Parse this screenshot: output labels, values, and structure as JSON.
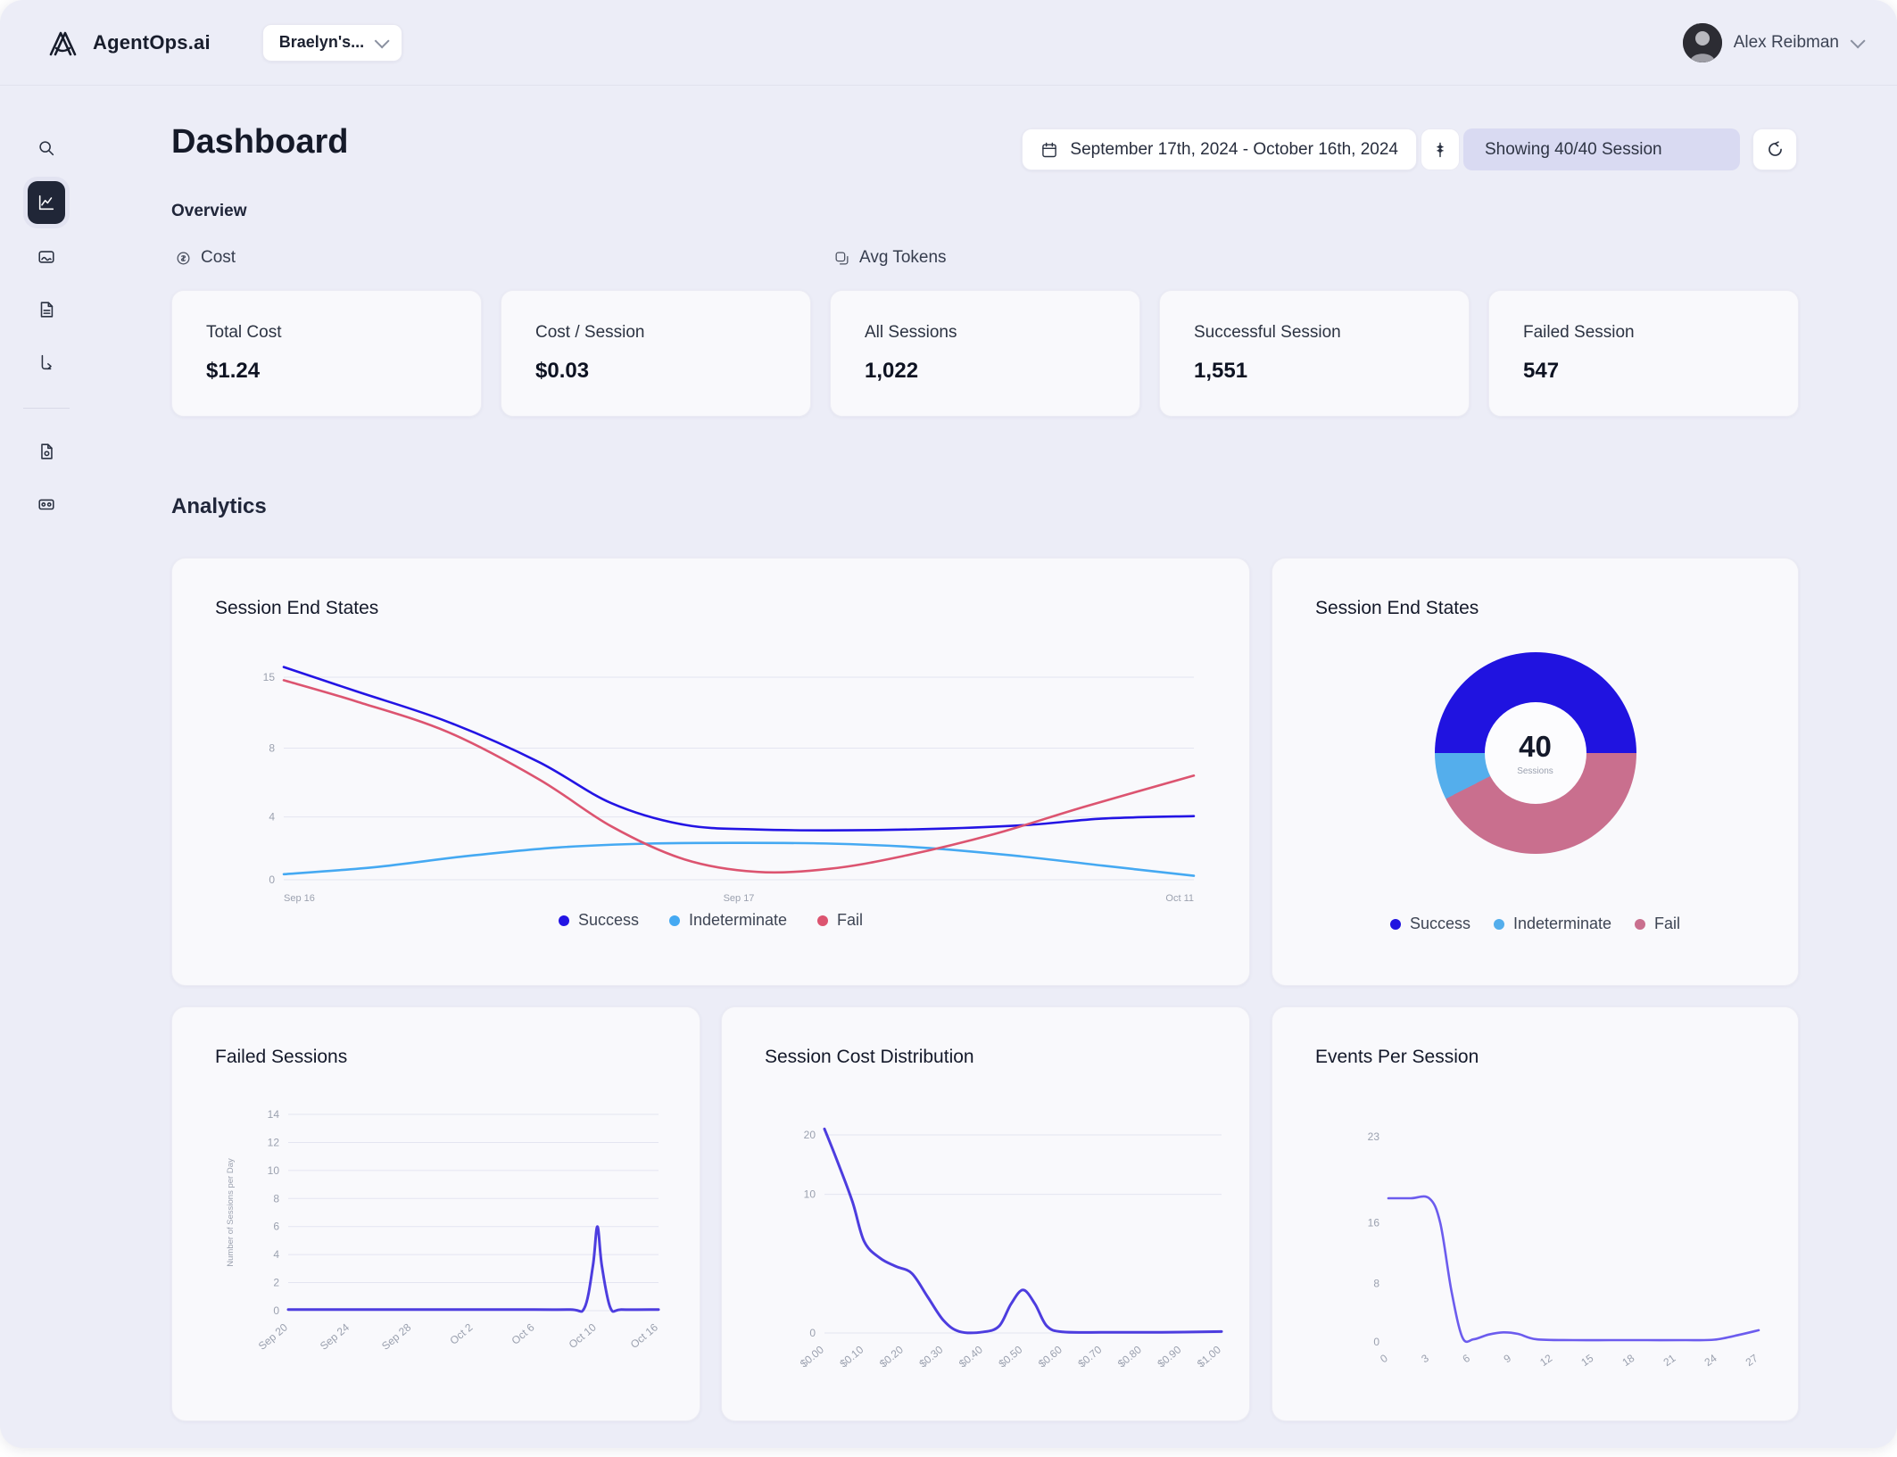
{
  "topbar": {
    "brand": "AgentOps.ai",
    "project_selector": "Braelyn's...",
    "user_name": "Alex Reibman"
  },
  "sidebar": {
    "items": [
      {
        "name": "search"
      },
      {
        "name": "dashboard",
        "active": true
      },
      {
        "name": "sessions"
      },
      {
        "name": "logs"
      },
      {
        "name": "traces"
      },
      {
        "name": "docs"
      },
      {
        "name": "api-keys"
      }
    ]
  },
  "header": {
    "title": "Dashboard",
    "date_range": "September 17th, 2024 - October 16th, 2024",
    "showing": "Showing 40/40 Session"
  },
  "overview": {
    "section_label": "Overview",
    "toggles": [
      {
        "label": "Cost",
        "icon": "coin-icon"
      },
      {
        "label": "Avg Tokens",
        "icon": "tokens-icon"
      }
    ],
    "cards": [
      {
        "label": "Total Cost",
        "value": "$1.24"
      },
      {
        "label": "Cost / Session",
        "value": "$0.03"
      },
      {
        "label": "All Sessions",
        "value": "1,022"
      },
      {
        "label": "Successful Session",
        "value": "1,551"
      },
      {
        "label": "Failed Session",
        "value": "547"
      }
    ]
  },
  "analytics": {
    "section_label": "Analytics"
  },
  "colors": {
    "success": "#2314e4",
    "indeterminate": "#45a9f2",
    "fail": "#dc5470",
    "fail_donut": "#c96f8e",
    "indigo_line": "#4d3ddf",
    "events_line": "#6c5cee",
    "grid": "#e4e5f1",
    "tick_text": "#9ba1af"
  },
  "chart_data": [
    {
      "type": "line",
      "title": "Session End States",
      "legend": [
        "Success",
        "Indeterminate",
        "Fail"
      ],
      "x_labels": [
        "Sep 16",
        "Sep 17",
        "Oct 11"
      ],
      "x_label_fracs": [
        0,
        0.5,
        1
      ],
      "y_ticks": [
        {
          "label": "0",
          "v": 0,
          "f": 0
        },
        {
          "label": "4",
          "v": 4,
          "f": 0.31
        },
        {
          "label": "8",
          "v": 8,
          "f": 0.65
        },
        {
          "label": "15",
          "v": 15,
          "f": 1
        }
      ],
      "series": [
        {
          "name": "Success",
          "color": "#2314e4",
          "points": [
            [
              0,
              16
            ],
            [
              0.08,
              13.6
            ],
            [
              0.18,
              10.6
            ],
            [
              0.28,
              7.2
            ],
            [
              0.36,
              4.8
            ],
            [
              0.44,
              3.5
            ],
            [
              0.52,
              3.2
            ],
            [
              0.62,
              3.15
            ],
            [
              0.72,
              3.25
            ],
            [
              0.82,
              3.5
            ],
            [
              0.9,
              3.9
            ],
            [
              1,
              4.05
            ]
          ]
        },
        {
          "name": "Indeterminate",
          "color": "#45a9f2",
          "points": [
            [
              0,
              0.35
            ],
            [
              0.1,
              0.8
            ],
            [
              0.2,
              1.5
            ],
            [
              0.3,
              2.05
            ],
            [
              0.4,
              2.3
            ],
            [
              0.5,
              2.35
            ],
            [
              0.6,
              2.3
            ],
            [
              0.7,
              2.05
            ],
            [
              0.8,
              1.55
            ],
            [
              0.9,
              0.9
            ],
            [
              1,
              0.25
            ]
          ]
        },
        {
          "name": "Fail",
          "color": "#dc5470",
          "points": [
            [
              0,
              14.7
            ],
            [
              0.08,
              12.6
            ],
            [
              0.18,
              9.6
            ],
            [
              0.28,
              6.2
            ],
            [
              0.36,
              3.4
            ],
            [
              0.44,
              1.3
            ],
            [
              0.52,
              0.5
            ],
            [
              0.6,
              0.7
            ],
            [
              0.68,
              1.5
            ],
            [
              0.78,
              2.9
            ],
            [
              0.88,
              4.6
            ],
            [
              1,
              6.4
            ]
          ]
        }
      ]
    },
    {
      "type": "pie",
      "title": "Session End States",
      "center_value": "40",
      "center_label": "Sessions",
      "legend": [
        "Success",
        "Indeterminate",
        "Fail"
      ],
      "slices": [
        {
          "label": "Success",
          "value": 20,
          "color": "#2013e0"
        },
        {
          "label": "Fail",
          "value": 17,
          "color": "#c96f8e"
        },
        {
          "label": "Indeterminate",
          "value": 3,
          "color": "#54aeec"
        }
      ],
      "total": 40
    },
    {
      "type": "line",
      "title": "Failed Sessions",
      "ylabel": "Number of Sessions per Day",
      "x_labels": [
        "Sep 20",
        "Sep 24",
        "Sep 28",
        "Oct 2",
        "Oct 6",
        "Oct 10",
        "Oct 16"
      ],
      "y_ticks": [
        {
          "label": "0",
          "v": 0,
          "f": 0
        },
        {
          "label": "2",
          "v": 2,
          "f": 0.1429
        },
        {
          "label": "4",
          "v": 4,
          "f": 0.2857
        },
        {
          "label": "6",
          "v": 6,
          "f": 0.4286
        },
        {
          "label": "8",
          "v": 8,
          "f": 0.5714
        },
        {
          "label": "10",
          "v": 10,
          "f": 0.7143
        },
        {
          "label": "12",
          "v": 12,
          "f": 0.8571
        },
        {
          "label": "14",
          "v": 14,
          "f": 1
        }
      ],
      "series": [
        {
          "name": "Failed Sessions",
          "color": "#4d3ddf",
          "points": [
            [
              0,
              0.08
            ],
            [
              0.2,
              0.08
            ],
            [
              0.4,
              0.08
            ],
            [
              0.6,
              0.08
            ],
            [
              0.76,
              0.08
            ],
            [
              0.8,
              0.2
            ],
            [
              0.823,
              3.2
            ],
            [
              0.835,
              6
            ],
            [
              0.847,
              3.2
            ],
            [
              0.87,
              0.2
            ],
            [
              0.9,
              0.08
            ],
            [
              1,
              0.08
            ]
          ]
        }
      ]
    },
    {
      "type": "line",
      "title": "Session Cost Distribution",
      "x_labels": [
        "$0.00",
        "$0.10",
        "$0.20",
        "$0.30",
        "$0.40",
        "$0.50",
        "$0.60",
        "$0.70",
        "$0.80",
        "$0.90",
        "$1.00"
      ],
      "y_ticks": [
        {
          "label": "0",
          "v": 0,
          "f": 0
        },
        {
          "label": "10",
          "v": 10,
          "f": 0.7
        },
        {
          "label": "20",
          "v": 20,
          "f": 1
        }
      ],
      "series": [
        {
          "name": "Sessions",
          "color": "#4d3ddf",
          "points": [
            [
              0,
              21
            ],
            [
              0.03,
              16
            ],
            [
              0.07,
              9.5
            ],
            [
              0.1,
              6.6
            ],
            [
              0.14,
              5.4
            ],
            [
              0.18,
              4.8
            ],
            [
              0.22,
              4.3
            ],
            [
              0.26,
              2.6
            ],
            [
              0.3,
              0.9
            ],
            [
              0.34,
              0.1
            ],
            [
              0.4,
              0.08
            ],
            [
              0.44,
              0.5
            ],
            [
              0.47,
              2.1
            ],
            [
              0.5,
              3.1
            ],
            [
              0.53,
              2.1
            ],
            [
              0.56,
              0.5
            ],
            [
              0.6,
              0.08
            ],
            [
              0.7,
              0.05
            ],
            [
              0.85,
              0.05
            ],
            [
              1,
              0.1
            ]
          ]
        }
      ]
    },
    {
      "type": "line",
      "title": "Events Per Session",
      "x_labels": [
        "0",
        "3",
        "6",
        "9",
        "12",
        "15",
        "18",
        "21",
        "24",
        "27"
      ],
      "y_ticks": [
        {
          "label": "0",
          "v": 0,
          "f": 0
        },
        {
          "label": "8",
          "v": 8,
          "f": 0.285
        },
        {
          "label": "16",
          "v": 16,
          "f": 0.58
        },
        {
          "label": "23",
          "v": 23,
          "f": 1
        }
      ],
      "series": [
        {
          "name": "Events",
          "color": "#6c5cee",
          "points": [
            [
              0,
              18
            ],
            [
              0.06,
              18
            ],
            [
              0.11,
              18
            ],
            [
              0.14,
              16
            ],
            [
              0.17,
              7
            ],
            [
              0.2,
              0.6
            ],
            [
              0.23,
              0.35
            ],
            [
              0.27,
              1
            ],
            [
              0.31,
              1.3
            ],
            [
              0.35,
              1.1
            ],
            [
              0.4,
              0.35
            ],
            [
              0.5,
              0.25
            ],
            [
              0.6,
              0.25
            ],
            [
              0.7,
              0.25
            ],
            [
              0.8,
              0.25
            ],
            [
              0.88,
              0.3
            ],
            [
              0.95,
              1
            ],
            [
              1,
              1.6
            ]
          ]
        }
      ]
    }
  ]
}
